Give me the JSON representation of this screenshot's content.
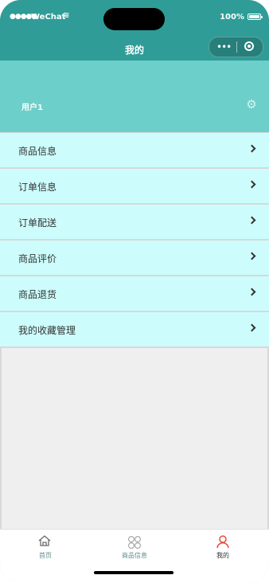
{
  "status_bar": {
    "signal": "●●●●●",
    "carrier": "WeChat",
    "wifi": "≋",
    "battery": "100%"
  },
  "nav": {
    "title": "我的",
    "capsule_dots": "•••"
  },
  "profile": {
    "username": "用户1",
    "settings_icon": "gear-icon"
  },
  "menu": {
    "items": [
      {
        "label": "商品信息"
      },
      {
        "label": "订单信息"
      },
      {
        "label": "订单配送"
      },
      {
        "label": "商品评价"
      },
      {
        "label": "商品退货"
      },
      {
        "label": "我的收藏管理"
      }
    ]
  },
  "tabbar": {
    "items": [
      {
        "label": "首页",
        "icon": "home-icon"
      },
      {
        "label": "商品信息",
        "icon": "grid-icon"
      },
      {
        "label": "我的",
        "icon": "user-icon"
      }
    ]
  },
  "colors": {
    "accent": "#2f9c97",
    "profile_bg": "#6ccfc9",
    "menu_bg": "#ccfdfc",
    "page_bg": "#efefef",
    "active_tab": "#e94b3c"
  }
}
